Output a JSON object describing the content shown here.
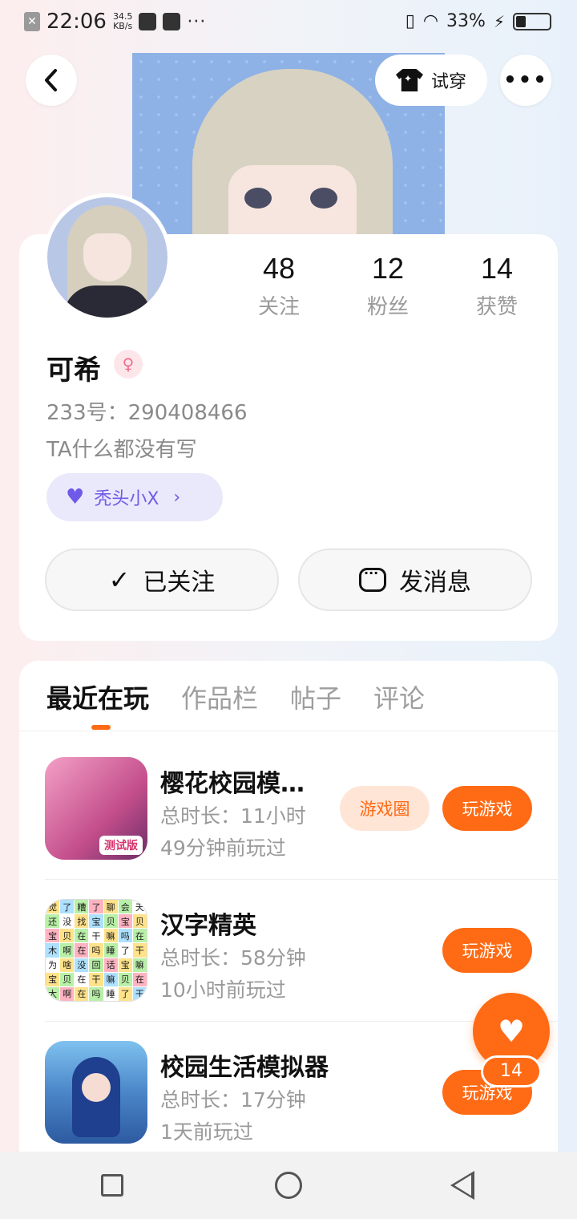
{
  "status_bar": {
    "time": "22:06",
    "speed_value": "34.5",
    "speed_unit": "KB/s",
    "dots": "···",
    "battery": "33%"
  },
  "header": {
    "try_on_label": "试穿",
    "more_label": "•••"
  },
  "profile": {
    "stats": [
      {
        "value": "48",
        "label": "关注"
      },
      {
        "value": "12",
        "label": "粉丝"
      },
      {
        "value": "14",
        "label": "获赞"
      }
    ],
    "nickname": "可希",
    "gender_symbol": "♀",
    "id_text": "233号：290408466",
    "bio": "TA什么都没有写",
    "badge_label": "秃头小X",
    "followed_label": "已关注",
    "message_label": "发消息"
  },
  "tabs": [
    "最近在玩",
    "作品栏",
    "帖子",
    "评论"
  ],
  "games": [
    {
      "title": "樱花校园模…",
      "duration": "总时长：11小时",
      "last_played": "49分钟前玩过",
      "circle_label": "游戏圈",
      "play_label": "玩游戏",
      "icon_tag": "测试版"
    },
    {
      "title": "汉字精英",
      "duration": "总时长：58分钟",
      "last_played": "10小时前玩过",
      "play_label": "玩游戏"
    },
    {
      "title": "校园生活模拟器",
      "duration": "总时长：17分钟",
      "last_played": "1天前玩过",
      "play_label": "玩游戏"
    }
  ],
  "hanzi_grid": [
    "觉",
    "了",
    "糟",
    "了",
    "聊",
    "会",
    "天",
    "还",
    "没",
    "找",
    "宝",
    "贝",
    "宝",
    "贝",
    "宝",
    "贝",
    "在",
    "干",
    "嘛",
    "吗",
    "在",
    "木",
    "啊",
    "在",
    "吗",
    "睡",
    "了",
    "干",
    "为",
    "啥",
    "没",
    "回",
    "话",
    "宝",
    "嘛",
    "宝",
    "贝",
    "在",
    "干",
    "嘛",
    "贝",
    "在",
    "大",
    "啊",
    "在",
    "吗",
    "睡",
    "了",
    "干"
  ],
  "like": {
    "count": "14"
  },
  "colors": {
    "accent": "#ff6a14",
    "badge": "#6f5ae8"
  }
}
